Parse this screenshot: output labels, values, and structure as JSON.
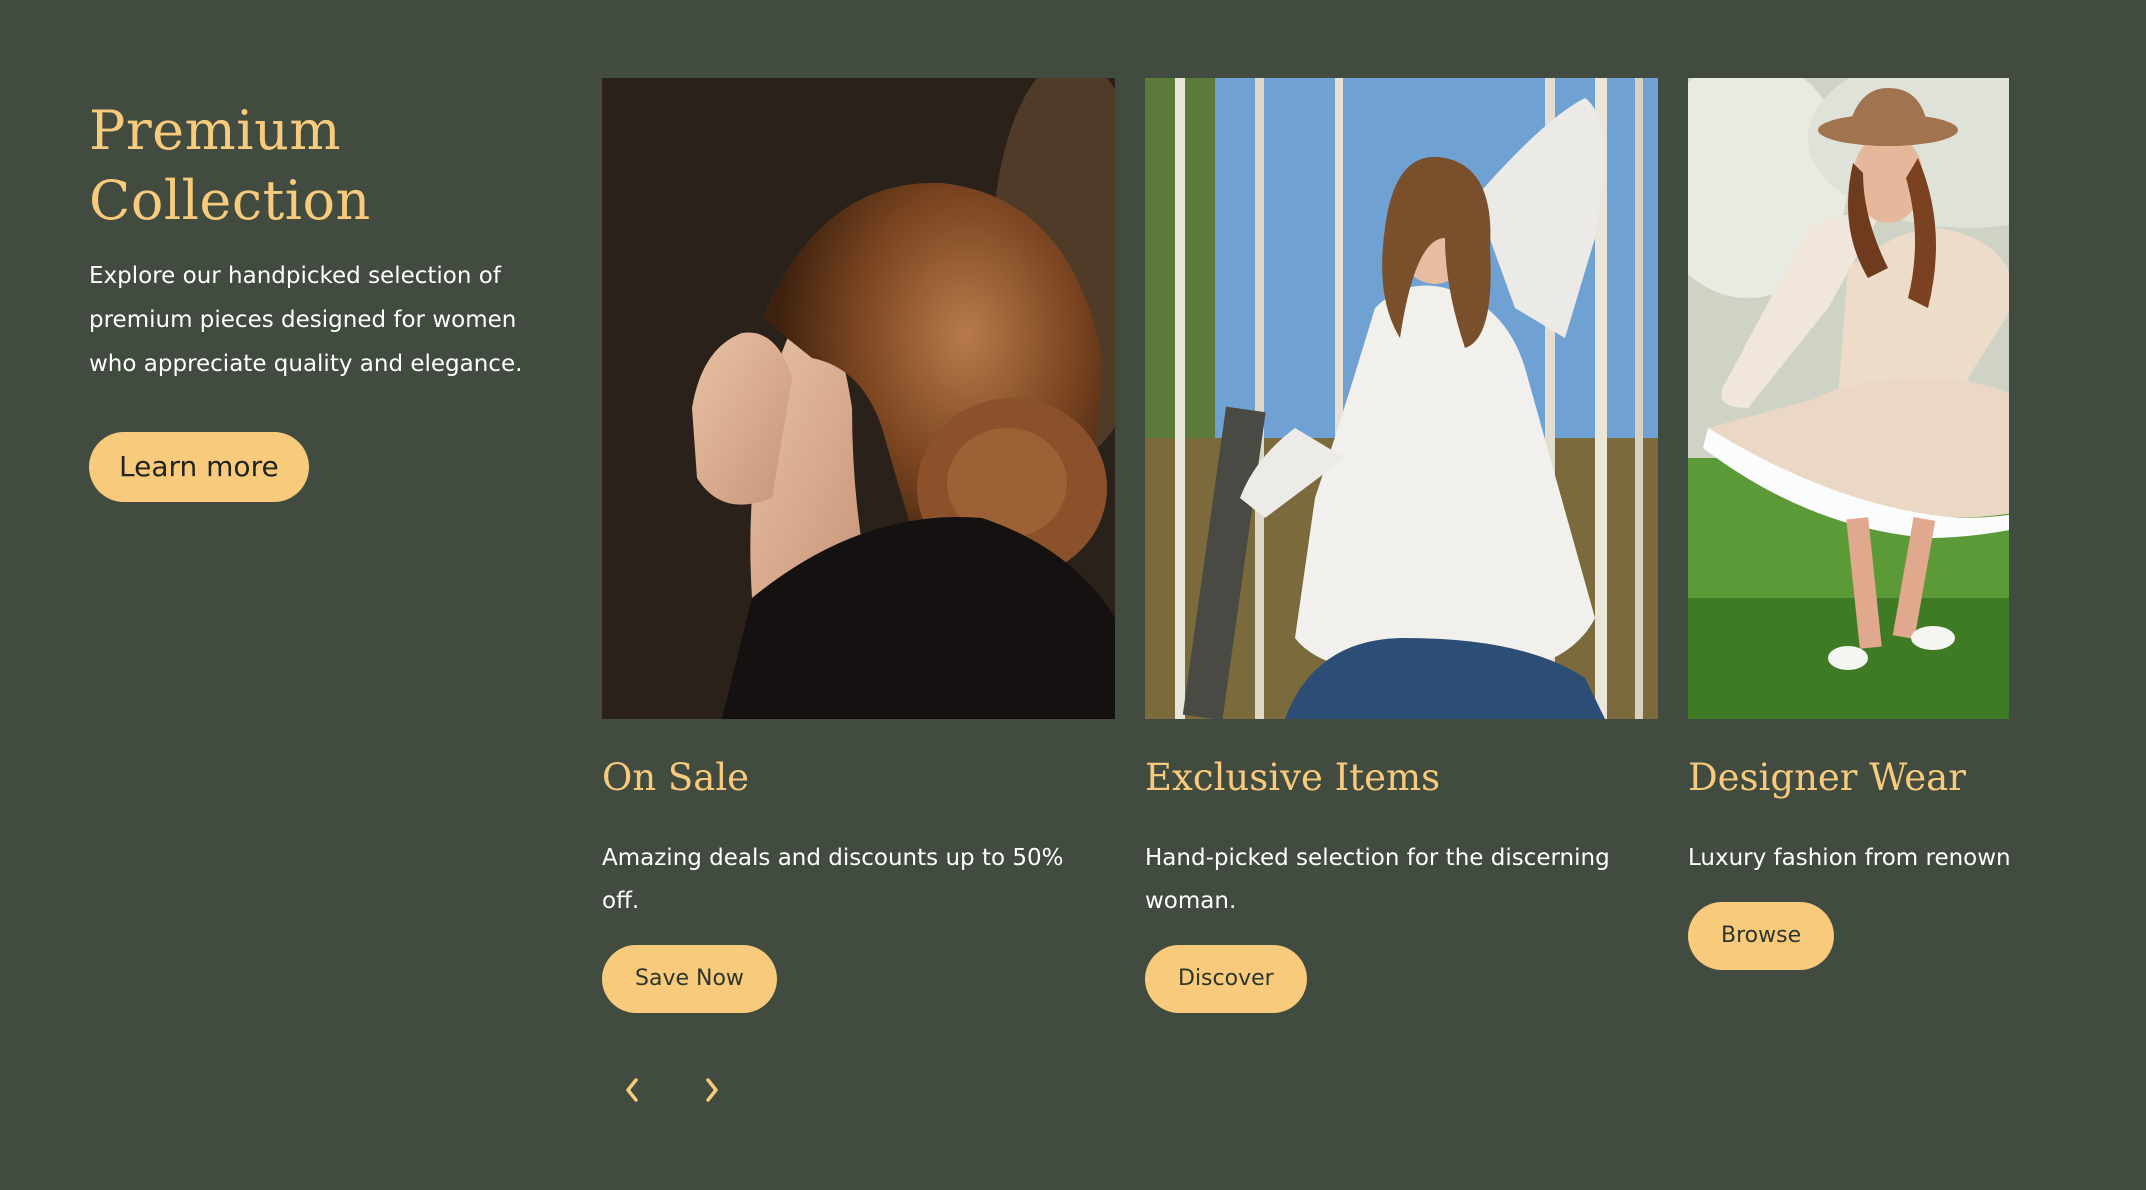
{
  "intro": {
    "title_line1": "Premium",
    "title_line2": "Collection",
    "description": "Explore our handpicked selection of premium pieces designed for women who appreciate quality and elegance.",
    "cta_label": "Learn more"
  },
  "cards": [
    {
      "title": "On Sale",
      "description": "Amazing deals and discounts up to 50% off.",
      "button_label": "Save Now",
      "image": "woman-hair-bun-profile-photo"
    },
    {
      "title": "Exclusive Items",
      "description": "Hand-picked selection for the discerning woman.",
      "button_label": "Discover",
      "image": "woman-white-sweater-birch-trees-photo"
    },
    {
      "title": "Designer Wear",
      "description": "Luxury fashion from renowned designers.",
      "button_label": "Browse",
      "image": "woman-dress-hat-garden-photo"
    }
  ],
  "nav": {
    "prev_icon": "chevron-left-icon",
    "next_icon": "chevron-right-icon"
  },
  "colors": {
    "background": "#424b40",
    "accent": "#f8ca7c",
    "text": "#ffffff"
  }
}
